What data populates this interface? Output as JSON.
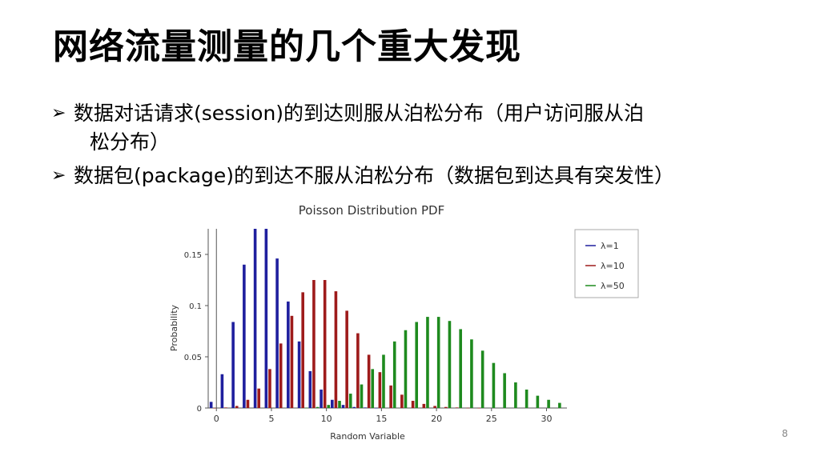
{
  "slide": {
    "title": "网络流量测量的几个重大发现",
    "bullets": [
      {
        "arrow": "➢",
        "line1": "数据对话请求(session)的到达则服从泊松分布（用户访问服从泊",
        "line2": "松分布）"
      },
      {
        "arrow": "➢",
        "line1": "数据包(package)的到达不服从泊松分布（数据包到达具有突发性）",
        "line2": ""
      }
    ],
    "page_number": "8"
  },
  "chart_data": {
    "type": "bar",
    "title": "Poisson Distribution PDF",
    "xlabel": "Random Variable",
    "ylabel": "Probability",
    "xlim": [
      -0.6,
      32
    ],
    "ylim": [
      0,
      0.175
    ],
    "x_ticks": [
      0,
      5,
      10,
      15,
      20,
      25,
      30
    ],
    "y_ticks": [
      0,
      0.05,
      0.1,
      0.15
    ],
    "legend_position": "right",
    "grid": false,
    "x": [
      0,
      1,
      2,
      3,
      4,
      5,
      6,
      7,
      8,
      9,
      10,
      11,
      12,
      13,
      14,
      15,
      16,
      17,
      18,
      19,
      20,
      21,
      22,
      23,
      24,
      25,
      26,
      27,
      28,
      29,
      30,
      31
    ],
    "series": [
      {
        "name": "λ=1",
        "color": "#1f1f9e",
        "values": [
          0.006,
          0.033,
          0.084,
          0.14,
          0.175,
          0.175,
          0.146,
          0.104,
          0.065,
          0.036,
          0.018,
          0.008,
          0.003,
          0.001,
          0.0005,
          0.0001,
          0,
          0,
          0,
          0,
          0,
          0,
          0,
          0,
          0,
          0,
          0,
          0,
          0,
          0,
          0,
          0
        ]
      },
      {
        "name": "λ=10",
        "color": "#9e1b1b",
        "values": [
          5e-05,
          0.0005,
          0.002,
          0.008,
          0.019,
          0.038,
          0.063,
          0.09,
          0.113,
          0.125,
          0.125,
          0.114,
          0.095,
          0.073,
          0.052,
          0.035,
          0.022,
          0.013,
          0.007,
          0.004,
          0.002,
          0.001,
          0.0005,
          0.0002,
          0.0001,
          0,
          0,
          0,
          0,
          0,
          0,
          0
        ]
      },
      {
        "name": "λ=50",
        "color": "#1e8a1e",
        "values": [
          0,
          0,
          0,
          0,
          0,
          0,
          0,
          0,
          0.0003,
          0.001,
          0.003,
          0.007,
          0.014,
          0.023,
          0.038,
          0.052,
          0.065,
          0.076,
          0.084,
          0.089,
          0.089,
          0.085,
          0.077,
          0.067,
          0.056,
          0.044,
          0.034,
          0.025,
          0.018,
          0.012,
          0.008,
          0.005
        ]
      }
    ]
  }
}
